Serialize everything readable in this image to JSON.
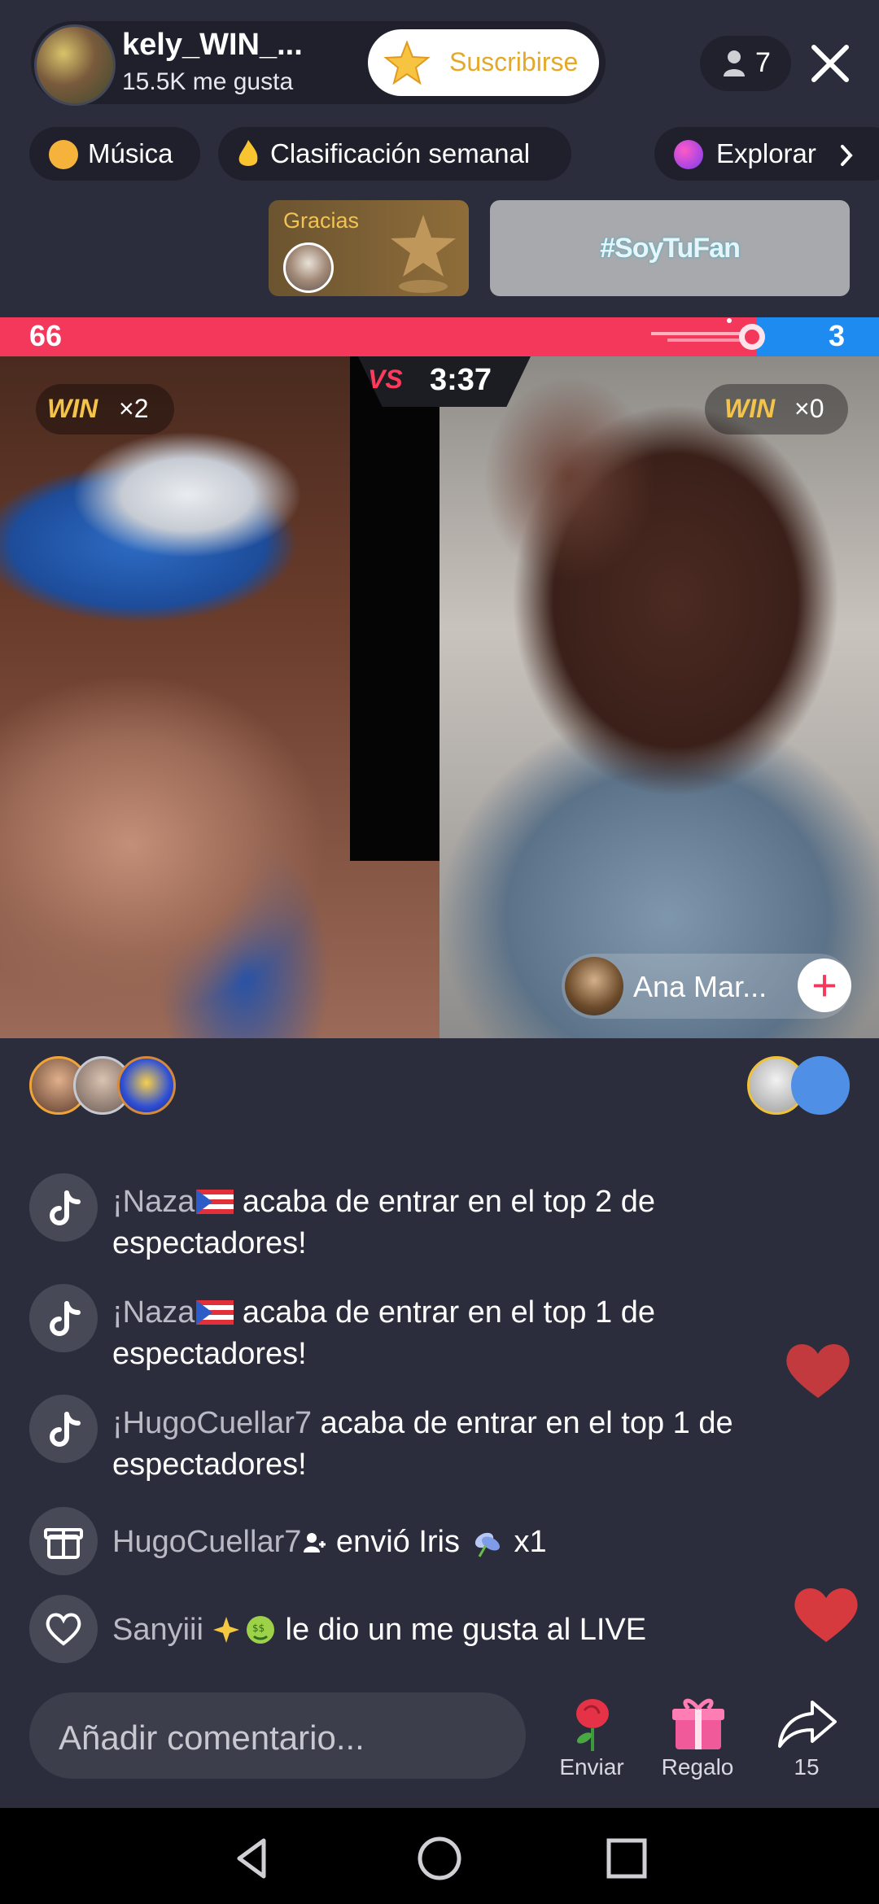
{
  "header": {
    "host_name": "kely_WIN_...",
    "likes": "15.5K me gusta",
    "subscribe_label": "Suscribirse",
    "viewer_count": "7"
  },
  "chips": [
    {
      "label": "Música",
      "icon": "music-icon"
    },
    {
      "label": "Clasificación semanal",
      "icon": "flame-icon"
    },
    {
      "label": "Explorar",
      "icon": "planet-icon"
    }
  ],
  "banners": {
    "gracias_label": "Gracias",
    "fan_label": "#SoyTuFan"
  },
  "battle": {
    "score_left": "66",
    "score_right": "3",
    "progress_left_fraction": 0.86,
    "vs_label": "VS",
    "timer": "3:37",
    "left": {
      "win_word": "WIN",
      "win_mult": "×2"
    },
    "right": {
      "win_word": "WIN",
      "win_mult": "×0"
    },
    "guest_name": "Ana Mar..."
  },
  "comments": [
    {
      "icon": "tiktok-icon",
      "user": "¡Naza",
      "flag": "puerto-rico-flag",
      "text": " acaba de entrar en el top 2 de espectadores!"
    },
    {
      "icon": "tiktok-icon",
      "user": "¡Naza",
      "flag": "puerto-rico-flag",
      "text": " acaba de entrar en el top 1 de espectadores!"
    },
    {
      "icon": "tiktok-icon",
      "user": "¡HugoCuellar7",
      "text": " acaba de entrar en el top 1 de espectadores!"
    },
    {
      "icon": "gift-icon",
      "user": "HugoCuellar7",
      "text": " envió Iris",
      "suffix": " x1"
    },
    {
      "icon": "heart-icon",
      "user": "Sanyiii",
      "text": " le dio un me gusta al LIVE"
    }
  ],
  "bottom": {
    "comment_placeholder": "Añadir comentario...",
    "send_label": "Enviar",
    "gift_label": "Regalo",
    "share_count": "15"
  },
  "colors": {
    "background": "#2b2d3d",
    "score_red": "#f4385c",
    "score_blue": "#1d8bf0",
    "subscribe_text": "#e5a92a",
    "win_gold": "#f4c34a"
  }
}
